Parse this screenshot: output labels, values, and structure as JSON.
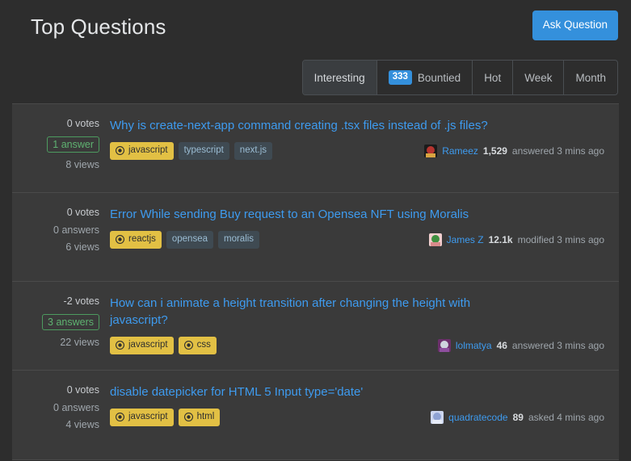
{
  "header": {
    "title": "Top Questions",
    "ask_button_label": "Ask Question"
  },
  "filter_tabs": [
    {
      "label": "Interesting",
      "selected": true,
      "badge": null
    },
    {
      "label": "Bountied",
      "selected": false,
      "badge": "333"
    },
    {
      "label": "Hot",
      "selected": false,
      "badge": null
    },
    {
      "label": "Week",
      "selected": false,
      "badge": null
    },
    {
      "label": "Month",
      "selected": false,
      "badge": null
    }
  ],
  "colors": {
    "accent": "#3490dc",
    "link": "#3e9bef",
    "watched_tag": "#e2c044",
    "tag": "#3f4a52",
    "answered_green": "#5fb371",
    "panel_bg": "#3a3a3a",
    "page_bg": "#2d2d2d"
  },
  "questions": [
    {
      "votes": "0 votes",
      "answers": "1 answer",
      "answers_accepted": true,
      "views": "8 views",
      "title": "Why is create-next-app command creating .tsx files instead of .js files?",
      "tags": [
        {
          "name": "javascript",
          "watched": true
        },
        {
          "name": "typescript",
          "watched": false
        },
        {
          "name": "next.js",
          "watched": false
        }
      ],
      "user": {
        "name": "Rameez",
        "reputation": "1,529",
        "action": "answered 3 mins ago",
        "avatar_colors": [
          "#1b1b1b",
          "#b5342f",
          "#d9a441"
        ]
      }
    },
    {
      "votes": "0 votes",
      "answers": "0 answers",
      "answers_accepted": false,
      "views": "6 views",
      "title": "Error While sending Buy request to an Opensea NFT using Moralis",
      "tags": [
        {
          "name": "reactjs",
          "watched": true
        },
        {
          "name": "opensea",
          "watched": false
        },
        {
          "name": "moralis",
          "watched": false
        }
      ],
      "user": {
        "name": "James Z",
        "reputation": "12.1k",
        "action": "modified 3 mins ago",
        "avatar_colors": [
          "#f2cfcf",
          "#3f8f3f",
          "#d88b8b"
        ]
      }
    },
    {
      "votes": "-2 votes",
      "answers": "3 answers",
      "answers_accepted": true,
      "views": "22 views",
      "title": "How can i animate a height transition after changing the height with javascript?",
      "tags": [
        {
          "name": "javascript",
          "watched": true
        },
        {
          "name": "css",
          "watched": true
        }
      ],
      "user": {
        "name": "lolmatya",
        "reputation": "46",
        "action": "answered 3 mins ago",
        "avatar_colors": [
          "#6b2f6b",
          "#cfd4de",
          "#8e4f9e"
        ]
      }
    },
    {
      "votes": "0 votes",
      "answers": "0 answers",
      "answers_accepted": false,
      "views": "4 views",
      "title": "disable datepicker for HTML 5 Input type='date'",
      "tags": [
        {
          "name": "javascript",
          "watched": true
        },
        {
          "name": "html",
          "watched": true
        }
      ],
      "user": {
        "name": "quadratecode",
        "reputation": "89",
        "action": "asked 4 mins ago",
        "avatar_colors": [
          "#ccd6f0",
          "#8ea2d4",
          "#e6ecf8"
        ]
      }
    }
  ]
}
